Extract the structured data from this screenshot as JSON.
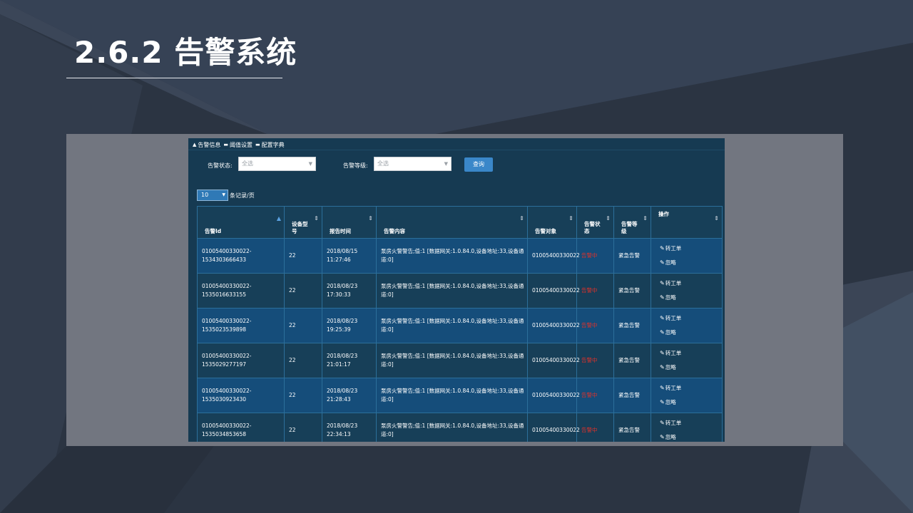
{
  "slide": {
    "title": "2.6.2 告警系统"
  },
  "tabs": [
    {
      "icon": "warning-icon",
      "glyph": "▲",
      "label": "告警信息"
    },
    {
      "icon": "card-icon",
      "glyph": "▬",
      "label": "阈值设置"
    },
    {
      "icon": "card-icon",
      "glyph": "▬",
      "label": "配置字典"
    }
  ],
  "filters": {
    "status_label": "告警状态:",
    "status_value": "全选",
    "level_label": "告警等级:",
    "level_value": "全选",
    "query_label": "查询"
  },
  "pagination": {
    "page_size": "10",
    "page_size_label": "条记录/页"
  },
  "table": {
    "columns": [
      "告警Id",
      "设备型号",
      "报告时间",
      "告警内容",
      "告警对象",
      "告警状态",
      "告警等级",
      "操作"
    ],
    "column_lines": [
      [
        "告警Id"
      ],
      [
        "设备型",
        "号"
      ],
      [
        "报告时间"
      ],
      [
        "告警内容"
      ],
      [
        "告警对象"
      ],
      [
        "告警状",
        "态"
      ],
      [
        "告警等",
        "级"
      ],
      [
        "操作"
      ]
    ],
    "actions": {
      "transfer": "转工单",
      "ignore": "忽略"
    },
    "rows": [
      {
        "id": [
          "01005400330022-",
          "1534303666433"
        ],
        "model": "22",
        "time": [
          "2018/08/15",
          "11:27:46"
        ],
        "content": [
          "泵房火警警告;值:1 [数据网关:1.0.84.0,设备地址:33,设备通",
          "道:0]"
        ],
        "object": "01005400330022",
        "status": "告警中",
        "level": "紧急告警"
      },
      {
        "id": [
          "01005400330022-",
          "1535016633155"
        ],
        "model": "22",
        "time": [
          "2018/08/23",
          "17:30:33"
        ],
        "content": [
          "泵房火警警告;值:1 [数据网关:1.0.84.0,设备地址:33,设备通",
          "道:0]"
        ],
        "object": "01005400330022",
        "status": "告警中",
        "level": "紧急告警"
      },
      {
        "id": [
          "01005400330022-",
          "1535023539898"
        ],
        "model": "22",
        "time": [
          "2018/08/23",
          "19:25:39"
        ],
        "content": [
          "泵房火警警告;值:1 [数据网关:1.0.84.0,设备地址:33,设备通",
          "道:0]"
        ],
        "object": "01005400330022",
        "status": "告警中",
        "level": "紧急告警"
      },
      {
        "id": [
          "01005400330022-",
          "1535029277197"
        ],
        "model": "22",
        "time": [
          "2018/08/23",
          "21:01:17"
        ],
        "content": [
          "泵房火警警告;值:1 [数据网关:1.0.84.0,设备地址:33,设备通",
          "道:0]"
        ],
        "object": "01005400330022",
        "status": "告警中",
        "level": "紧急告警"
      },
      {
        "id": [
          "01005400330022-",
          "1535030923430"
        ],
        "model": "22",
        "time": [
          "2018/08/23",
          "21:28:43"
        ],
        "content": [
          "泵房火警警告;值:1 [数据网关:1.0.84.0,设备地址:33,设备通",
          "道:0]"
        ],
        "object": "01005400330022",
        "status": "告警中",
        "level": "紧急告警"
      },
      {
        "id": [
          "01005400330022-",
          "1535034853658"
        ],
        "model": "22",
        "time": [
          "2018/08/23",
          "22:34:13"
        ],
        "content": [
          "泵房火警警告;值:1 [数据网关:1.0.84.0,设备地址:33,设备通",
          "道:0]"
        ],
        "object": "01005400330022",
        "status": "告警中",
        "level": "紧急告警"
      }
    ]
  },
  "colors": {
    "status_alert": "#e0312a",
    "accent": "#3a87c9",
    "row_a": "#154d7a",
    "row_b": "#173f58"
  }
}
